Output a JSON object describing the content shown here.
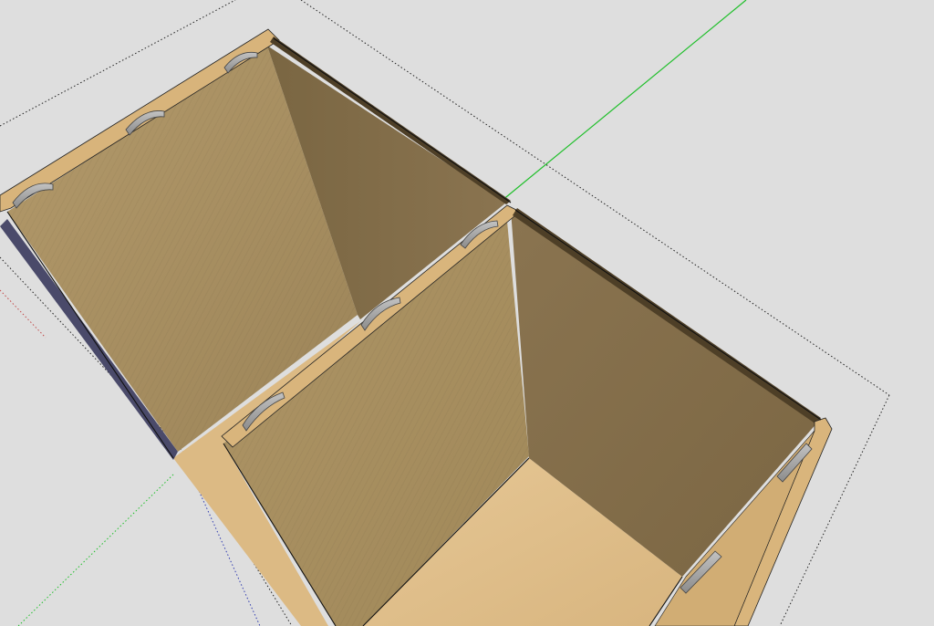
{
  "viewport": {
    "background": "#dedede",
    "description_labels": []
  },
  "scene": {
    "model": "cabinet",
    "compartments": 2,
    "shelf_pin_icons": 8,
    "colors": {
      "panel_edge": "#d9b57c",
      "panel_edge_dark": "#c79f63",
      "back_wall_lit": "#ad9263",
      "back_wall_shade": "#7e6a45",
      "floor": "#e0bf8c",
      "pin": "#a5a5a5",
      "pin_dark": "#7d7d7d",
      "outline": "#111111",
      "axis_green": "#1fbf2a",
      "axis_blue": "#2f3ab0",
      "axis_red": "#c24a4a",
      "bbox_dotted": "#222222"
    }
  }
}
